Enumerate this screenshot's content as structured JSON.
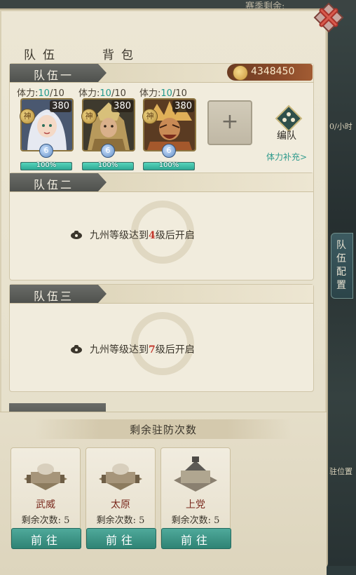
{
  "top_tabs": [
    "队伍",
    "背包"
  ],
  "background": {
    "top_text": "赛季剩余:",
    "right_text_1": "0/小时",
    "right_text_2": "驻位置"
  },
  "coins": "4348450",
  "side_tab": "队伍配置",
  "teams": [
    {
      "name": "队伍一",
      "stamina_label": "体力:",
      "heroes": [
        {
          "stamina_cur": "10",
          "stamina_max": "/10",
          "level": "380",
          "badge": "神",
          "cls": "6",
          "hp": 1.0,
          "hp_text": "100%",
          "palette": "#cdd6e6"
        },
        {
          "stamina_cur": "10",
          "stamina_max": "/10",
          "level": "380",
          "badge": "神",
          "cls": "6",
          "hp": 1.0,
          "hp_text": "100%",
          "palette": "#b89a5c"
        },
        {
          "stamina_cur": "10",
          "stamina_max": "/10",
          "level": "380",
          "badge": "神",
          "cls": "6",
          "hp": 1.0,
          "hp_text": "100%",
          "palette": "#c57a3c"
        }
      ],
      "add_slot": "+",
      "form_label": "编队",
      "refill_label": "体力补充>"
    },
    {
      "name": "队伍二",
      "lock_prefix": "九州等级达到",
      "lock_level": "4",
      "lock_suffix": "级后开启"
    },
    {
      "name": "队伍三",
      "lock_prefix": "九州等级达到",
      "lock_level": "7",
      "lock_suffix": "级后开启"
    }
  ],
  "garrison": {
    "title": "剩余驻防次数",
    "cities": [
      {
        "name": "武威",
        "remaining": "剩余次数: 5",
        "button": "前往"
      },
      {
        "name": "太原",
        "remaining": "剩余次数: 5",
        "button": "前往"
      },
      {
        "name": "上党",
        "remaining": "剩余次数: 5",
        "button": "前往"
      }
    ]
  },
  "colors": {
    "accent_teal": "#2e9a8c",
    "lock_red": "#c2372c",
    "header_dark": "#5a5c58"
  },
  "icons": {
    "close": "close-icon",
    "coin": "coin-icon",
    "formation": "formation-icon",
    "lock": "lock-icon",
    "plus": "plus-icon"
  }
}
